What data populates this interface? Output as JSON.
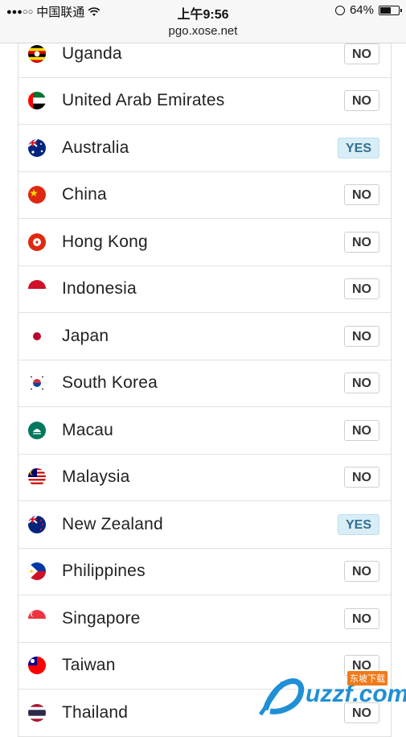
{
  "status_bar": {
    "carrier": "中国联通",
    "time": "上午9:56",
    "battery": "64%",
    "battery_level": 0.64
  },
  "url": "pgo.xose.net",
  "countries": [
    {
      "name": "Uganda",
      "status": "NO",
      "flag": "uganda"
    },
    {
      "name": "United Arab Emirates",
      "status": "NO",
      "flag": "uae"
    },
    {
      "name": "Australia",
      "status": "YES",
      "flag": "australia"
    },
    {
      "name": "China",
      "status": "NO",
      "flag": "china"
    },
    {
      "name": "Hong Kong",
      "status": "NO",
      "flag": "hongkong"
    },
    {
      "name": "Indonesia",
      "status": "NO",
      "flag": "indonesia"
    },
    {
      "name": "Japan",
      "status": "NO",
      "flag": "japan"
    },
    {
      "name": "South Korea",
      "status": "NO",
      "flag": "southkorea"
    },
    {
      "name": "Macau",
      "status": "NO",
      "flag": "macau"
    },
    {
      "name": "Malaysia",
      "status": "NO",
      "flag": "malaysia"
    },
    {
      "name": "New Zealand",
      "status": "YES",
      "flag": "newzealand"
    },
    {
      "name": "Philippines",
      "status": "NO",
      "flag": "philippines"
    },
    {
      "name": "Singapore",
      "status": "NO",
      "flag": "singapore"
    },
    {
      "name": "Taiwan",
      "status": "NO",
      "flag": "taiwan"
    },
    {
      "name": "Thailand",
      "status": "NO",
      "flag": "thailand"
    }
  ],
  "watermark": {
    "text": "uzzf.com",
    "tag": "东坡下载"
  }
}
